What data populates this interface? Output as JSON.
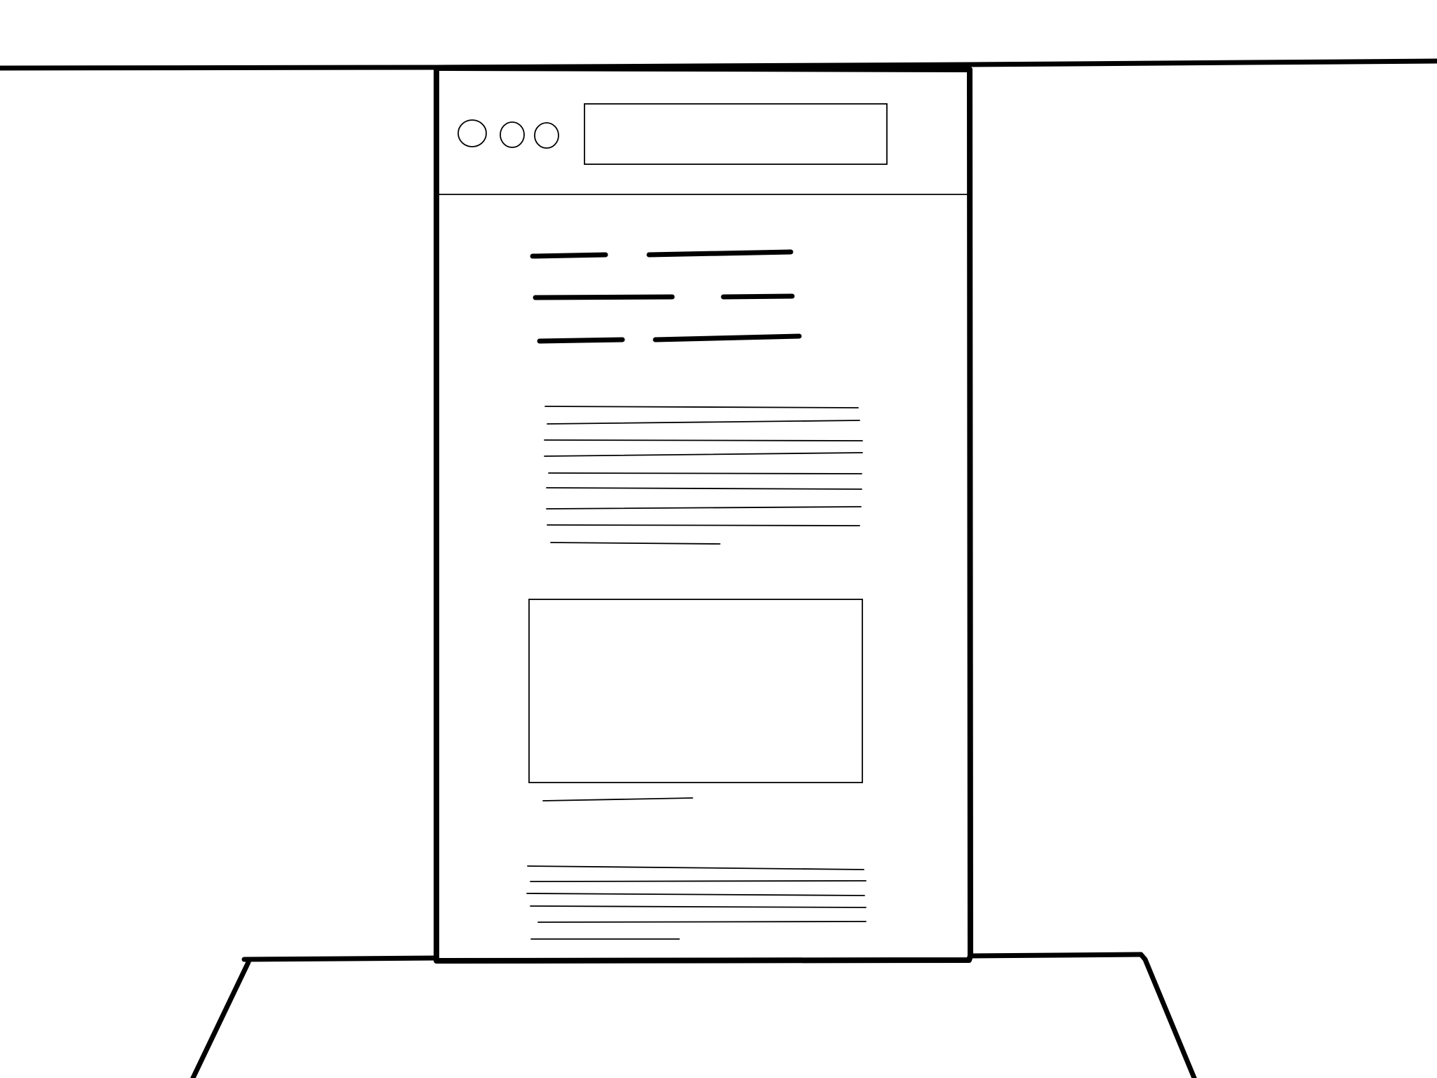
{
  "colors": {
    "background": "#ffffff",
    "ink": "#000000"
  },
  "scene": {
    "shelf_line": "plain",
    "floor_lines": "plain"
  },
  "window": {
    "controls": [
      {
        "icon": "window-control-circle-icon"
      },
      {
        "icon": "window-control-circle-icon"
      },
      {
        "icon": "window-control-circle-icon"
      }
    ],
    "address_bar": {
      "value": "",
      "placeholder": ""
    }
  },
  "content": {
    "heading_rows": 3,
    "heading_columns": 2,
    "paragraph_1_lines": 9,
    "image_placeholder": "empty-rectangle",
    "caption_lines": 1,
    "paragraph_2_lines": 6
  }
}
